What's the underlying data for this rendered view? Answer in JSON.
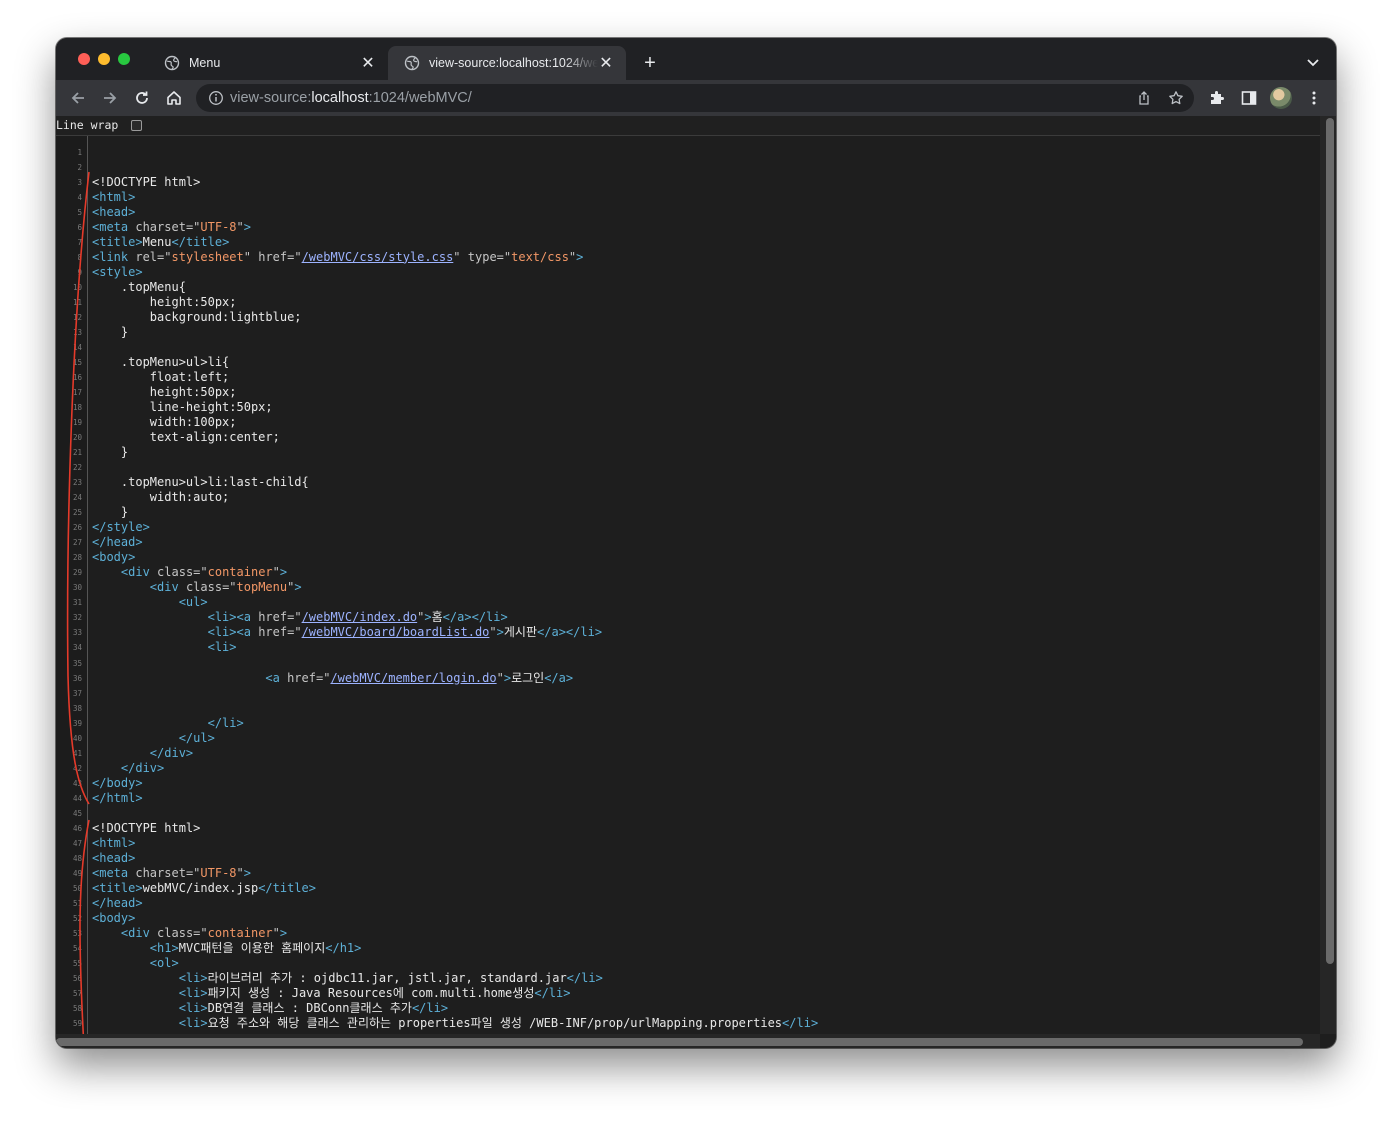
{
  "browser": {
    "tabs": [
      {
        "title": "Menu",
        "active": false
      },
      {
        "title": "view-source:localhost:1024/webMVC/",
        "active": true
      }
    ],
    "omnibox": {
      "scheme": "view-source:",
      "host": "localhost",
      "path": ":1024/webMVC/"
    }
  },
  "viewer": {
    "line_wrap_label": "Line wrap",
    "line_wrap_checked": false
  },
  "source_lines": [
    {
      "n": 1,
      "text": ""
    },
    {
      "n": 2,
      "text": ""
    },
    {
      "n": 3,
      "text": "<!DOCTYPE html>",
      "kind": "doctype"
    },
    {
      "n": 4,
      "text": "<html>",
      "kind": "tag"
    },
    {
      "n": 5,
      "text": "<head>",
      "kind": "tag"
    },
    {
      "n": 6,
      "text": "<meta charset=\"UTF-8\">",
      "kind": "tag"
    },
    {
      "n": 7,
      "text": "<title>Menu</title>",
      "kind": "tag"
    },
    {
      "n": 8,
      "text": "<link rel=\"stylesheet\" href=\"/webMVC/css/style.css\" type=\"text/css\">",
      "kind": "tag"
    },
    {
      "n": 9,
      "text": "<style>",
      "kind": "tag"
    },
    {
      "n": 10,
      "text": "    .topMenu{"
    },
    {
      "n": 11,
      "text": "        height:50px;"
    },
    {
      "n": 12,
      "text": "        background:lightblue;"
    },
    {
      "n": 13,
      "text": "    }"
    },
    {
      "n": 14,
      "text": ""
    },
    {
      "n": 15,
      "text": "    .topMenu>ul>li{"
    },
    {
      "n": 16,
      "text": "        float:left;"
    },
    {
      "n": 17,
      "text": "        height:50px;"
    },
    {
      "n": 18,
      "text": "        line-height:50px;"
    },
    {
      "n": 19,
      "text": "        width:100px;"
    },
    {
      "n": 20,
      "text": "        text-align:center;"
    },
    {
      "n": 21,
      "text": "    }"
    },
    {
      "n": 22,
      "text": ""
    },
    {
      "n": 23,
      "text": "    .topMenu>ul>li:last-child{"
    },
    {
      "n": 24,
      "text": "        width:auto;"
    },
    {
      "n": 25,
      "text": "    }"
    },
    {
      "n": 26,
      "text": "</style>",
      "kind": "tag"
    },
    {
      "n": 27,
      "text": "</head>",
      "kind": "tag"
    },
    {
      "n": 28,
      "text": "<body>",
      "kind": "tag"
    },
    {
      "n": 29,
      "text": "    <div class=\"container\">",
      "kind": "tag"
    },
    {
      "n": 30,
      "text": "        <div class=\"topMenu\">",
      "kind": "tag"
    },
    {
      "n": 31,
      "text": "            <ul>",
      "kind": "tag"
    },
    {
      "n": 32,
      "text": "                <li><a href=\"/webMVC/index.do\">홈</a></li>",
      "kind": "tag"
    },
    {
      "n": 33,
      "text": "                <li><a href=\"/webMVC/board/boardList.do\">게시판</a></li>",
      "kind": "tag"
    },
    {
      "n": 34,
      "text": "                <li>",
      "kind": "tag"
    },
    {
      "n": 35,
      "text": ""
    },
    {
      "n": 36,
      "text": "                        <a href=\"/webMVC/member/login.do\">로그인</a>",
      "kind": "tag"
    },
    {
      "n": 37,
      "text": ""
    },
    {
      "n": 38,
      "text": ""
    },
    {
      "n": 39,
      "text": "                </li>",
      "kind": "tag"
    },
    {
      "n": 40,
      "text": "            </ul>",
      "kind": "tag"
    },
    {
      "n": 41,
      "text": "        </div>",
      "kind": "tag"
    },
    {
      "n": 42,
      "text": "    </div>",
      "kind": "tag"
    },
    {
      "n": 43,
      "text": "</body>",
      "kind": "tag"
    },
    {
      "n": 44,
      "text": "</html>",
      "kind": "tag"
    },
    {
      "n": 45,
      "text": ""
    },
    {
      "n": 46,
      "text": "<!DOCTYPE html>",
      "kind": "doctype"
    },
    {
      "n": 47,
      "text": "<html>",
      "kind": "tag"
    },
    {
      "n": 48,
      "text": "<head>",
      "kind": "tag"
    },
    {
      "n": 49,
      "text": "<meta charset=\"UTF-8\">",
      "kind": "tag"
    },
    {
      "n": 50,
      "text": "<title>webMVC/index.jsp</title>",
      "kind": "tag"
    },
    {
      "n": 51,
      "text": "</head>",
      "kind": "tag"
    },
    {
      "n": 52,
      "text": "<body>",
      "kind": "tag"
    },
    {
      "n": 53,
      "text": "    <div class=\"container\">",
      "kind": "tag"
    },
    {
      "n": 54,
      "text": "        <h1>MVC패턴을 이용한 홈페이지</h1>",
      "kind": "tag"
    },
    {
      "n": 55,
      "text": "        <ol>",
      "kind": "tag"
    },
    {
      "n": 56,
      "text": "            <li>라이브러리 추가 : ojdbc11.jar, jstl.jar, standard.jar</li>",
      "kind": "tag"
    },
    {
      "n": 57,
      "text": "            <li>패키지 생성 : Java Resources에 com.multi.home생성</li>",
      "kind": "tag"
    },
    {
      "n": 58,
      "text": "            <li>DB연결 클래스 : DBConn클래스 추가</li>",
      "kind": "tag"
    },
    {
      "n": 59,
      "text": "            <li>요청 주소와 해당 클래스 관리하는 properties파일 생성 /WEB-INF/prop/urlMapping.properties</li>",
      "kind": "tag"
    }
  ]
}
